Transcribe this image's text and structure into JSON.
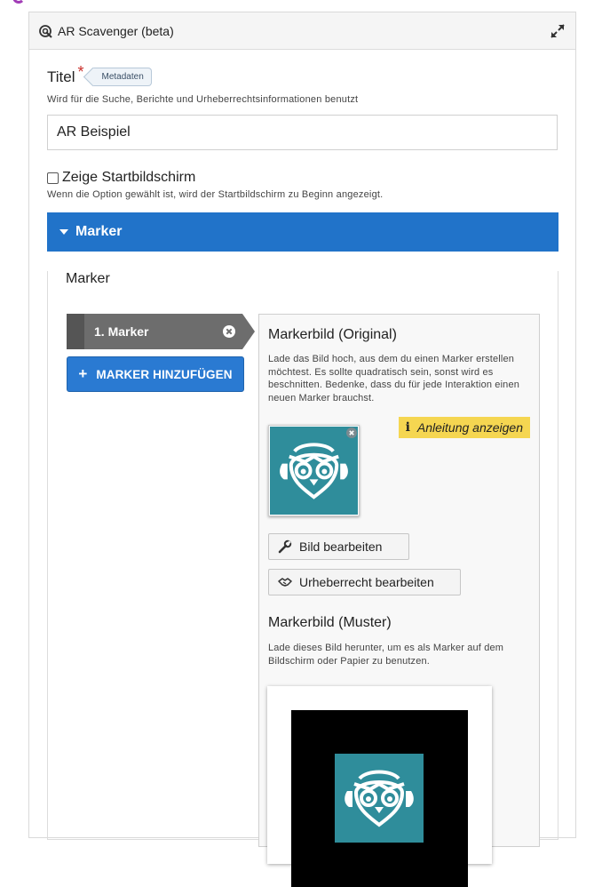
{
  "header": {
    "title": "AR Scavenger (beta)",
    "icon": "ar-scavenger-icon",
    "expand_icon": "expand-icon"
  },
  "title_field": {
    "label": "Titel",
    "required_mark": "*",
    "metadata_button": "Metadaten",
    "description": "Wird für die Suche, Berichte und Urheberrechtsinformationen benutzt",
    "value": "AR Beispiel"
  },
  "startscreen": {
    "label": "Zeige Startbildschirm",
    "checked": false,
    "description": "Wenn die Option gewählt ist, wird der Startbildschirm zu Beginn angezeigt."
  },
  "marker_group": {
    "title": "Marker",
    "list_label": "Marker",
    "items": [
      {
        "label": "1. Marker"
      }
    ],
    "add_button": "MARKER HINZUFÜGEN",
    "panel": {
      "original_heading": "Markerbild (Original)",
      "original_description": "Lade das Bild hoch, aus dem du einen Marker erstellen möchtest. Es sollte quadratisch sein, sonst wird es beschnitten. Bedenke, dass du für jede Interaktion einen neuen Marker brauchst.",
      "hint_button": "Anleitung anzeigen",
      "hint_icon": "i",
      "edit_image_button": "Bild bearbeiten",
      "edit_copyright_button": "Urheberrecht bearbeiten",
      "pattern_heading": "Markerbild (Muster)",
      "pattern_description": "Lade dieses Bild herunter, um es als Marker auf dem Bildschirm oder Papier zu benutzen."
    }
  },
  "colors": {
    "accent_blue": "#2173c9",
    "marker_gray": "#6d6d6d",
    "hint_yellow": "#f5d651",
    "owl_teal": "#2f8d9b"
  }
}
